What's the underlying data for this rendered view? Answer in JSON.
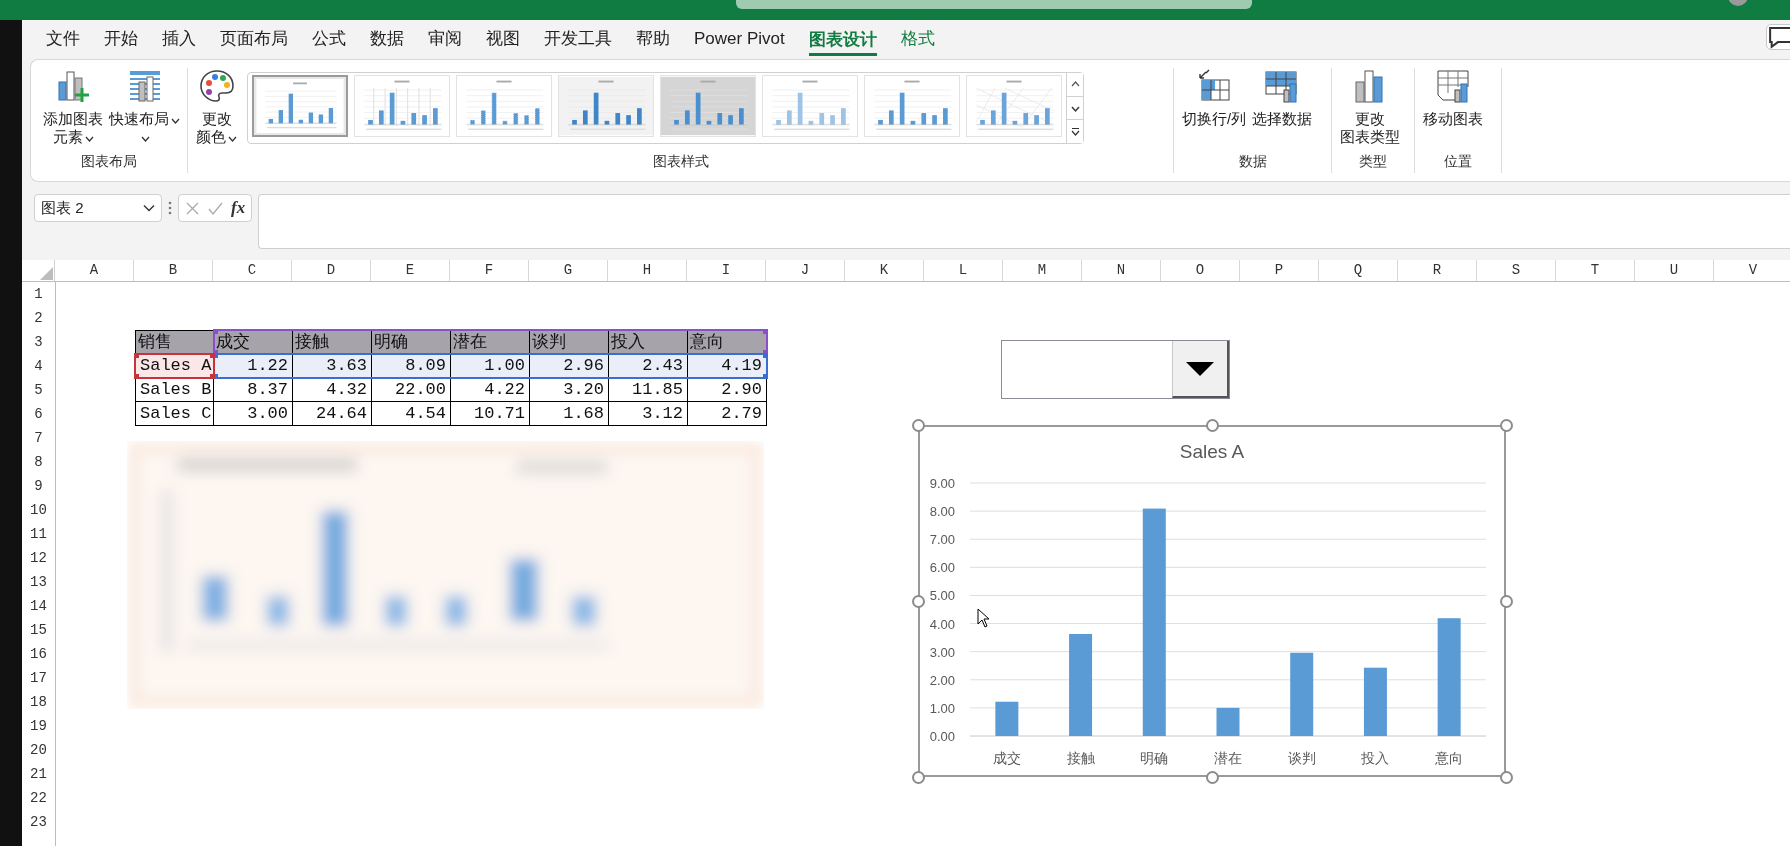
{
  "ribbon_tabs": [
    {
      "label": "文件",
      "selected": false,
      "contextual": false
    },
    {
      "label": "开始",
      "selected": false,
      "contextual": false
    },
    {
      "label": "插入",
      "selected": false,
      "contextual": false
    },
    {
      "label": "页面布局",
      "selected": false,
      "contextual": false
    },
    {
      "label": "公式",
      "selected": false,
      "contextual": false
    },
    {
      "label": "数据",
      "selected": false,
      "contextual": false
    },
    {
      "label": "审阅",
      "selected": false,
      "contextual": false
    },
    {
      "label": "视图",
      "selected": false,
      "contextual": false
    },
    {
      "label": "开发工具",
      "selected": false,
      "contextual": false
    },
    {
      "label": "帮助",
      "selected": false,
      "contextual": false
    },
    {
      "label": "Power Pivot",
      "selected": false,
      "contextual": false
    },
    {
      "label": "图表设计",
      "selected": true,
      "contextual": true
    },
    {
      "label": "格式",
      "selected": false,
      "contextual": true
    }
  ],
  "ribbon": {
    "groups": [
      {
        "label": "图表布局",
        "buttons": [
          {
            "kind": "add-element",
            "lines": [
              "添加图表",
              "元素"
            ],
            "dropdown": true
          },
          {
            "kind": "quick-layout",
            "lines": [
              "快速布局"
            ],
            "dropdown": true
          }
        ]
      },
      {
        "label": "图表样式",
        "buttons": [
          {
            "kind": "change-colors",
            "lines": [
              "更改",
              "颜色"
            ],
            "dropdown": true
          }
        ],
        "styles": [
          {
            "kind": "outline",
            "selected": true
          },
          {
            "kind": "columns",
            "selected": false
          },
          {
            "kind": "striped",
            "selected": false
          },
          {
            "kind": "gradient",
            "selected": false
          },
          {
            "kind": "shaded",
            "selected": false
          },
          {
            "kind": "light",
            "selected": false
          },
          {
            "kind": "plain",
            "selected": false
          },
          {
            "kind": "pattern",
            "selected": false
          }
        ]
      },
      {
        "label": "数据",
        "buttons": [
          {
            "kind": "switch",
            "lines": [
              "切换行/列"
            ],
            "dropdown": false
          },
          {
            "kind": "select-data",
            "lines": [
              "选择数据"
            ],
            "dropdown": false
          }
        ]
      },
      {
        "label": "类型",
        "buttons": [
          {
            "kind": "change-type",
            "lines": [
              "更改",
              "图表类型"
            ],
            "dropdown": false
          }
        ]
      },
      {
        "label": "位置",
        "buttons": [
          {
            "kind": "move-chart",
            "lines": [
              "移动图表"
            ],
            "dropdown": false
          }
        ]
      }
    ]
  },
  "formula_bar": {
    "name_box": "图表 2",
    "function_label": "fx"
  },
  "sheet": {
    "columns": [
      "A",
      "B",
      "C",
      "D",
      "E",
      "F",
      "G",
      "H",
      "I",
      "J",
      "K",
      "L",
      "M",
      "N",
      "O",
      "P",
      "Q",
      "R",
      "S",
      "T",
      "U",
      "V"
    ],
    "rows": [
      "1",
      "2",
      "3",
      "4",
      "5",
      "6",
      "7",
      "8",
      "9",
      "10",
      "11",
      "12",
      "13",
      "14",
      "15",
      "16",
      "17",
      "18",
      "19",
      "20",
      "21",
      "22",
      "23"
    ],
    "table": {
      "header": [
        "销售",
        "成交",
        "接触",
        "明确",
        "潜在",
        "谈判",
        "投入",
        "意向"
      ],
      "rows": [
        {
          "cells": [
            "Sales A",
            "1.22",
            "3.63",
            "8.09",
            "1.00",
            "2.96",
            "2.43",
            "4.19"
          ],
          "referenced": true
        },
        {
          "cells": [
            "Sales B",
            "8.37",
            "4.32",
            "22.00",
            "4.22",
            "3.20",
            "11.85",
            "2.90"
          ],
          "referenced": false
        },
        {
          "cells": [
            "Sales C",
            "3.00",
            "24.64",
            "4.54",
            "10.71",
            "1.68",
            "3.12",
            "2.79"
          ],
          "referenced": false
        }
      ]
    },
    "blurred_chart": {
      "kind": "picture"
    },
    "chart": {
      "chart_data": {
        "type": "bar",
        "title": "Sales A",
        "categories": [
          "成交",
          "接触",
          "明确",
          "潜在",
          "谈判",
          "投入",
          "意向"
        ],
        "series": [
          {
            "color": "#5b9bd5",
            "values": [
              1.22,
              3.63,
              8.09,
              1.0,
              2.96,
              2.43,
              4.19
            ]
          }
        ],
        "ylim": [
          0,
          9
        ],
        "grid": true,
        "yticks": [
          {
            "value": 0,
            "label": "0.00"
          },
          {
            "value": 1,
            "label": "1.00"
          },
          {
            "value": 2,
            "label": "2.00"
          },
          {
            "value": 3,
            "label": "3.00"
          },
          {
            "value": 4,
            "label": "4.00"
          },
          {
            "value": 5,
            "label": "5.00"
          },
          {
            "value": 6,
            "label": "6.00"
          },
          {
            "value": 7,
            "label": "7.00"
          },
          {
            "value": 8,
            "label": "8.00"
          },
          {
            "value": 9,
            "label": "9.00"
          }
        ]
      }
    }
  }
}
